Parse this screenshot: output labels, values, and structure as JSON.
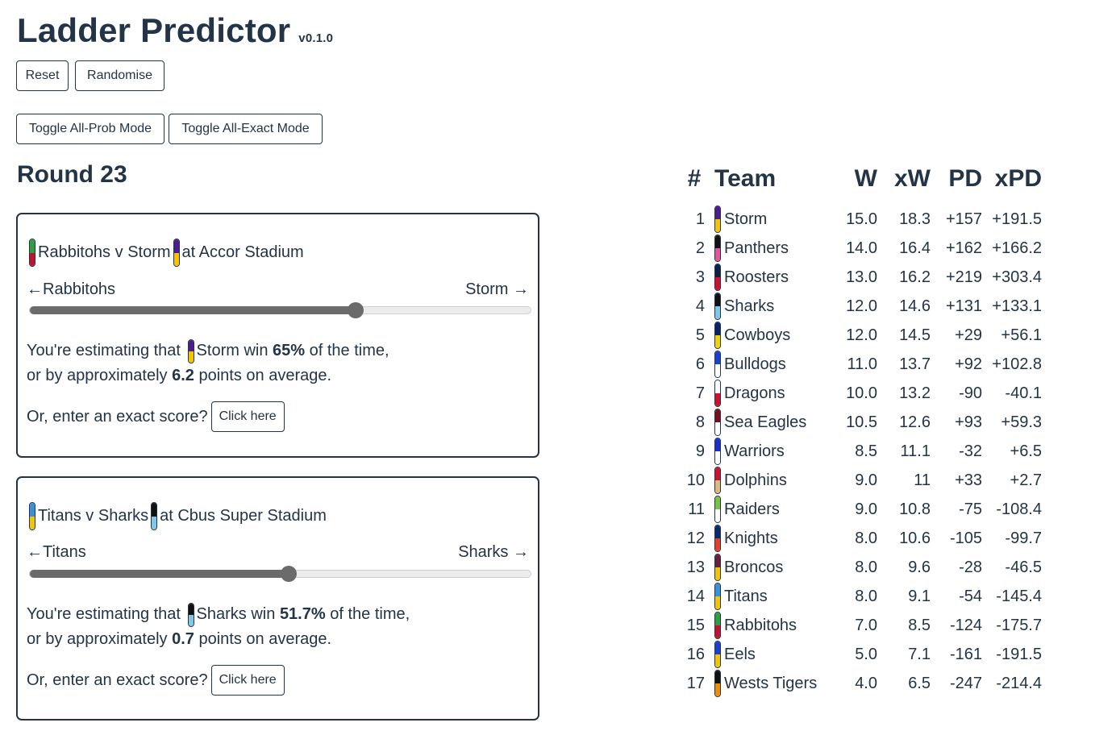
{
  "app": {
    "title": "Ladder Predictor",
    "version": "v0.1.0"
  },
  "buttons": {
    "reset": "Reset",
    "randomise": "Randomise",
    "toggle_prob": "Toggle All-Prob Mode",
    "toggle_exact": "Toggle All-Exact Mode"
  },
  "round": {
    "title": "Round 23",
    "matches": [
      {
        "home": "Rabbitohs",
        "v": "v",
        "away": "Storm",
        "venue": "at Accor Stadium",
        "home_colors": [
          "#2e9e3e",
          "#c8102e"
        ],
        "away_colors": [
          "#4b1d8f",
          "#f2c500"
        ],
        "left_label": "←Rabbitohs",
        "right_label": "Storm →",
        "slider_position": 0.65,
        "estimate_prefix": "You're estimating that",
        "winner": "Storm",
        "win_text": "win",
        "win_pct": "65%",
        "of_time": "of the time,",
        "margin_prefix": "or by approximately",
        "margin": "6.2",
        "margin_suffix": "points on average.",
        "winner_colors": [
          "#4b1d8f",
          "#f2c500"
        ],
        "exact_prompt": "Or, enter an exact score?",
        "exact_button": "Click here"
      },
      {
        "home": "Titans",
        "v": "v",
        "away": "Sharks",
        "venue": "at Cbus Super Stadium",
        "home_colors": [
          "#3a8fd9",
          "#f2c500"
        ],
        "away_colors": [
          "#111111",
          "#7fc8e8"
        ],
        "left_label": "←Titans",
        "right_label": "Sharks →",
        "slider_position": 0.517,
        "estimate_prefix": "You're estimating that",
        "winner": "Sharks",
        "win_text": "win",
        "win_pct": "51.7%",
        "of_time": "of the time,",
        "margin_prefix": "or by approximately",
        "margin": "0.7",
        "margin_suffix": "points on average.",
        "winner_colors": [
          "#111111",
          "#7fc8e8"
        ],
        "exact_prompt": "Or, enter an exact score?",
        "exact_button": "Click here"
      }
    ]
  },
  "ladder": {
    "headers": {
      "pos": "#",
      "team": "Team",
      "w": "W",
      "xw": "xW",
      "pd": "PD",
      "xpd": "xPD"
    },
    "rows": [
      {
        "pos": "1",
        "team": "Storm",
        "w": "15.0",
        "xw": "18.3",
        "pd": "+157",
        "xpd": "+191.5",
        "colors": [
          "#4b1d8f",
          "#f2c500"
        ]
      },
      {
        "pos": "2",
        "team": "Panthers",
        "w": "14.0",
        "xw": "16.4",
        "pd": "+162",
        "xpd": "+166.2",
        "colors": [
          "#111111",
          "#e8559a"
        ]
      },
      {
        "pos": "3",
        "team": "Roosters",
        "w": "13.0",
        "xw": "16.2",
        "pd": "+219",
        "xpd": "+303.4",
        "colors": [
          "#0b1f4d",
          "#d0102c"
        ]
      },
      {
        "pos": "4",
        "team": "Sharks",
        "w": "12.0",
        "xw": "14.6",
        "pd": "+131",
        "xpd": "+133.1",
        "colors": [
          "#111111",
          "#7fc8e8"
        ]
      },
      {
        "pos": "5",
        "team": "Cowboys",
        "w": "12.0",
        "xw": "14.5",
        "pd": "+29",
        "xpd": "+56.1",
        "colors": [
          "#0b1f6b",
          "#f2d500"
        ]
      },
      {
        "pos": "6",
        "team": "Bulldogs",
        "w": "11.0",
        "xw": "13.7",
        "pd": "+92",
        "xpd": "+102.8",
        "colors": [
          "#1b3fd1",
          "#ffffff"
        ]
      },
      {
        "pos": "7",
        "team": "Dragons",
        "w": "10.0",
        "xw": "13.2",
        "pd": "-90",
        "xpd": "-40.1",
        "colors": [
          "#ffffff",
          "#d0102c"
        ]
      },
      {
        "pos": "8",
        "team": "Sea Eagles",
        "w": "10.5",
        "xw": "12.6",
        "pd": "+93",
        "xpd": "+59.3",
        "colors": [
          "#7a0f1c",
          "#ffffff"
        ]
      },
      {
        "pos": "9",
        "team": "Warriors",
        "w": "8.5",
        "xw": "11.1",
        "pd": "-32",
        "xpd": "+6.5",
        "colors": [
          "#1b2fd1",
          "#ffffff"
        ]
      },
      {
        "pos": "10",
        "team": "Dolphins",
        "w": "9.0",
        "xw": "11",
        "pd": "+33",
        "xpd": "+2.7",
        "colors": [
          "#d0102c",
          "#e0b97a"
        ]
      },
      {
        "pos": "11",
        "team": "Raiders",
        "w": "9.0",
        "xw": "10.8",
        "pd": "-75",
        "xpd": "-108.4",
        "colors": [
          "#7cc242",
          "#ffffff"
        ]
      },
      {
        "pos": "12",
        "team": "Knights",
        "w": "8.0",
        "xw": "10.6",
        "pd": "-105",
        "xpd": "-99.7",
        "colors": [
          "#0b2a6b",
          "#e83e26"
        ]
      },
      {
        "pos": "13",
        "team": "Broncos",
        "w": "8.0",
        "xw": "9.6",
        "pd": "-28",
        "xpd": "-46.5",
        "colors": [
          "#6a1d3e",
          "#f2c500"
        ]
      },
      {
        "pos": "14",
        "team": "Titans",
        "w": "8.0",
        "xw": "9.1",
        "pd": "-54",
        "xpd": "-145.4",
        "colors": [
          "#3a8fd9",
          "#f2c500"
        ]
      },
      {
        "pos": "15",
        "team": "Rabbitohs",
        "w": "7.0",
        "xw": "8.5",
        "pd": "-124",
        "xpd": "-175.7",
        "colors": [
          "#2e9e3e",
          "#c8102e"
        ]
      },
      {
        "pos": "16",
        "team": "Eels",
        "w": "5.0",
        "xw": "7.1",
        "pd": "-161",
        "xpd": "-191.5",
        "colors": [
          "#1b3fd1",
          "#f2c500"
        ]
      },
      {
        "pos": "17",
        "team": "Wests Tigers",
        "w": "4.0",
        "xw": "6.5",
        "pd": "-247",
        "xpd": "-214.4",
        "colors": [
          "#111111",
          "#f28c00"
        ]
      }
    ]
  }
}
